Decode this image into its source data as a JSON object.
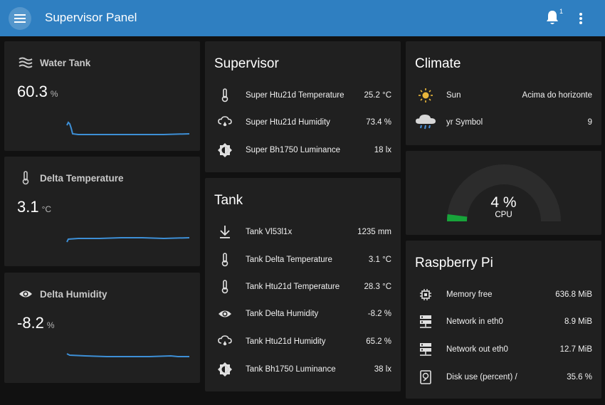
{
  "header": {
    "title": "Supervisor Panel",
    "notification_count": "1"
  },
  "colors": {
    "header_bg": "#2f7fc1",
    "card_bg": "#202020",
    "sparkline": "#3d8fd6",
    "gauge_fill": "#17a43a",
    "gauge_track": "#2c2c2c",
    "sun": "#e9b63b"
  },
  "sensors": [
    {
      "name": "Water Tank",
      "value": "60.3",
      "unit": "%",
      "icon": "waves-icon"
    },
    {
      "name": "Delta Temperature",
      "value": "3.1",
      "unit": "°C",
      "icon": "thermometer-icon"
    },
    {
      "name": "Delta Humidity",
      "value": "-8.2",
      "unit": "%",
      "icon": "eye-icon"
    }
  ],
  "supervisor": {
    "title": "Supervisor",
    "rows": [
      {
        "label": "Super Htu21d Temperature",
        "value": "25.2 °C",
        "icon": "thermometer-icon"
      },
      {
        "label": "Super Htu21d Humidity",
        "value": "73.4 %",
        "icon": "cloud-water-icon"
      },
      {
        "label": "Super Bh1750 Luminance",
        "value": "18 lx",
        "icon": "brightness-icon"
      }
    ]
  },
  "tank": {
    "title": "Tank",
    "rows": [
      {
        "label": "Tank Vl53l1x",
        "value": "1235 mm",
        "icon": "arrow-collapse-down-icon"
      },
      {
        "label": "Tank Delta Temperature",
        "value": "3.1 °C",
        "icon": "thermometer-icon"
      },
      {
        "label": "Tank Htu21d Temperature",
        "value": "28.3 °C",
        "icon": "thermometer-icon"
      },
      {
        "label": "Tank Delta Humidity",
        "value": "-8.2 %",
        "icon": "eye-icon"
      },
      {
        "label": "Tank Htu21d Humidity",
        "value": "65.2 %",
        "icon": "cloud-water-icon"
      },
      {
        "label": "Tank Bh1750 Luminance",
        "value": "38 lx",
        "icon": "brightness-icon"
      }
    ]
  },
  "climate": {
    "title": "Climate",
    "rows": [
      {
        "label": "Sun",
        "value": "Acima do horizonte",
        "icon": "sun-icon"
      },
      {
        "label": "yr Symbol",
        "value": "9",
        "icon": "rain-cloud-icon"
      }
    ]
  },
  "cpu_gauge": {
    "value": "4 %",
    "label": "CPU",
    "fraction": 0.04
  },
  "raspberry": {
    "title": "Raspberry Pi",
    "rows": [
      {
        "label": "Memory free",
        "value": "636.8 MiB",
        "icon": "chip-icon"
      },
      {
        "label": "Network in eth0",
        "value": "8.9 MiB",
        "icon": "server-network-icon"
      },
      {
        "label": "Network out eth0",
        "value": "12.7 MiB",
        "icon": "server-network-icon"
      },
      {
        "label": "Disk use (percent) /",
        "value": "35.6 %",
        "icon": "harddisk-icon"
      }
    ]
  }
}
